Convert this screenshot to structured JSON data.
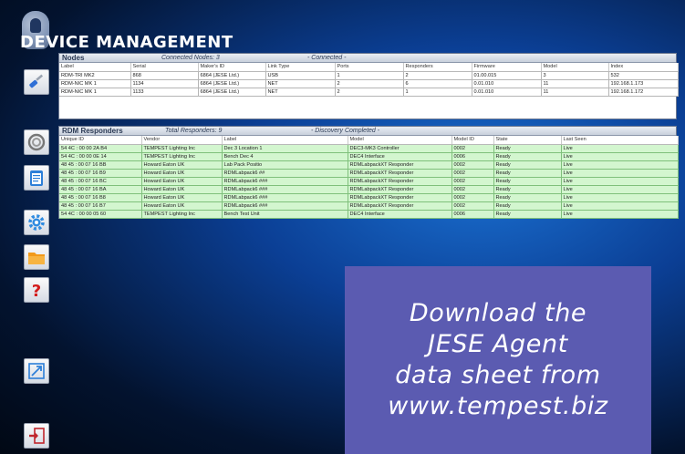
{
  "app": {
    "title": "DEVICE MANAGEMENT"
  },
  "sidebar": {
    "items": [
      {
        "icon": "screwdriver-icon"
      },
      {
        "icon": "refresh-icon"
      },
      {
        "icon": "clipboard-icon"
      },
      {
        "icon": "gear-icon"
      },
      {
        "icon": "folder-icon"
      },
      {
        "icon": "help-icon"
      },
      {
        "icon": "expand-icon"
      },
      {
        "icon": "exit-icon"
      }
    ]
  },
  "nodes": {
    "title": "Nodes",
    "count_text": "Connected Nodes: 3",
    "status_text": "- Connected -",
    "columns": [
      "Label",
      "Serial",
      "Maker's ID",
      "Link Type",
      "Ports",
      "Responders",
      "Firmware",
      "Model",
      "Index"
    ],
    "rows": [
      [
        "RDM-TRI MK2",
        "868",
        "6864 (JESE Ltd.)",
        "USB",
        "1",
        "2",
        "01.00.015",
        "3",
        "532"
      ],
      [
        "RDM-NIC MK 1",
        "1134",
        "6864 (JESE Ltd.)",
        "NET",
        "2",
        "6",
        "0.01.010",
        "11",
        "192.168.1.173"
      ],
      [
        "RDM-NIC MK 1",
        "1133",
        "6864 (JESE Ltd.)",
        "NET",
        "2",
        "1",
        "0.01.010",
        "11",
        "192.168.1.172"
      ]
    ]
  },
  "responders": {
    "title": "RDM Responders",
    "count_text": "Total Responders: 9",
    "status_text": "- Discovery Completed -",
    "columns": [
      "Unique ID",
      "Vendor",
      "Label",
      "Model",
      "Model ID",
      "State",
      "Last Seen"
    ],
    "rows": [
      [
        "54 4C : 00 00 2A B4",
        "TEMPEST Lighting Inc",
        "Dec 3 Location 1",
        "DEC3-MK3 Controller",
        "0002",
        "Ready",
        "Live"
      ],
      [
        "54 4C : 00 00 0E 14",
        "TEMPEST Lighting Inc",
        "Bench Dec 4",
        "DEC4 Interface",
        "0006",
        "Ready",
        "Live"
      ],
      [
        "48 45 : 00 07 16 BB",
        "Howard Eaton UK",
        "Lab Pack Positio",
        "RDMLabpackXT Responder",
        "0002",
        "Ready",
        "Live"
      ],
      [
        "48 45 : 00 07 16 B9",
        "Howard Eaton UK",
        "RDMLabpack6 ##",
        "RDMLabpackXT Responder",
        "0002",
        "Ready",
        "Live"
      ],
      [
        "48 45 : 00 07 16 BC",
        "Howard Eaton UK",
        "RDMLabpack6 ###",
        "RDMLabpackXT Responder",
        "0002",
        "Ready",
        "Live"
      ],
      [
        "48 45 : 00 07 16 BA",
        "Howard Eaton UK",
        "RDMLabpack6 ###",
        "RDMLabpackXT Responder",
        "0002",
        "Ready",
        "Live"
      ],
      [
        "48 45 : 00 07 16 B8",
        "Howard Eaton UK",
        "RDMLabpack6 ###",
        "RDMLabpackXT Responder",
        "0002",
        "Ready",
        "Live"
      ],
      [
        "48 45 : 00 07 16 B7",
        "Howard Eaton UK",
        "RDMLabpack6 ###",
        "RDMLabpackXT Responder",
        "0002",
        "Ready",
        "Live"
      ],
      [
        "54 4C : 00 00 05 60",
        "TEMPEST Lighting Inc",
        "Bench Test Unit",
        "DEC4 Interface",
        "0006",
        "Ready",
        "Live"
      ]
    ]
  },
  "promo": {
    "lines": [
      "Download the",
      "JESE Agent",
      "data sheet from",
      "www.tempest.biz"
    ]
  },
  "colors": {
    "responder_row_bg": "#d3f6cf",
    "promo_bg": "#5b5bb1",
    "help_icon": "#d31c1c",
    "folder_icon": "#f29a1a",
    "gear_icon": "#2f8be0"
  }
}
